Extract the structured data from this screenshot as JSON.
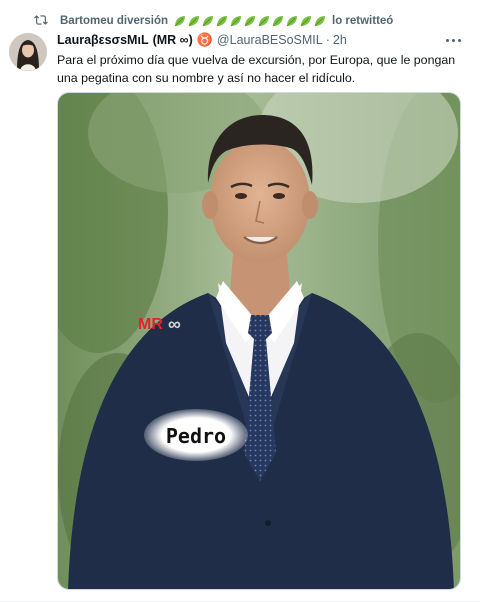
{
  "retweet": {
    "icon": "retweet-icon",
    "user": "Bartomeu diversión",
    "leaf_count": 11,
    "leaf_color": "#7ac143",
    "suffix": "lo retwitteó"
  },
  "tweet": {
    "display_name": "LauraβεsσsMιL",
    "name_tag": "(MR ∞)",
    "zodiac_symbol": "♉",
    "handle": "@LauraBESoSMIL",
    "separator": "·",
    "time": "2h",
    "text": "Para el próximo día que vuelva de excursión, por  Europa, que le pongan una pegatina con su nombre y así no hacer el ridículo.",
    "more_icon": "more-dots-icon"
  },
  "media": {
    "watermark_mr": "MR",
    "watermark_symbol": "∞",
    "sticker_label": "Pedro",
    "watermark_color": "#e0242b"
  },
  "colors": {
    "secondary_text": "#536471",
    "primary_text": "#0f1419",
    "suit": "#1f2d48",
    "tie": "#24345a"
  }
}
